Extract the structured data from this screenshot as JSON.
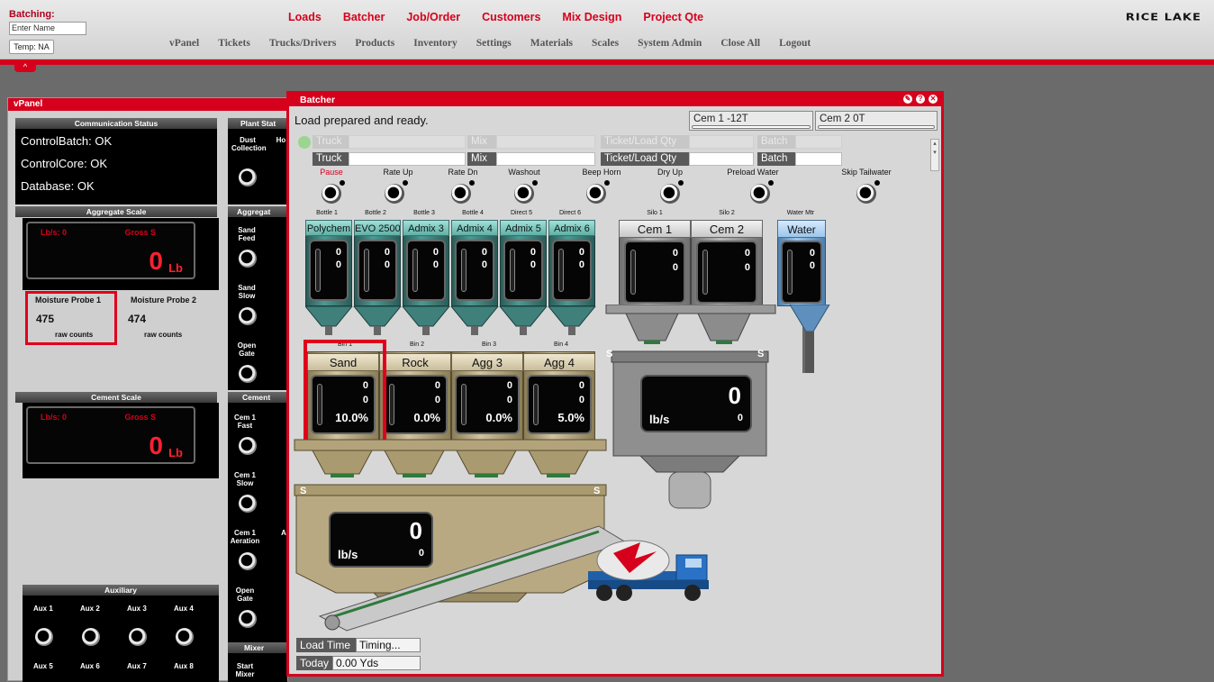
{
  "header": {
    "batching_label": "Batching:",
    "name_placeholder": "Enter Name",
    "temp_label": "Temp: NA",
    "logo": "RICE LAKE",
    "top_nav": [
      "Loads",
      "Batcher",
      "Job/Order",
      "Customers",
      "Mix Design",
      "Project Qte"
    ],
    "sub_nav": [
      "vPanel",
      "Tickets",
      "Trucks/Drivers",
      "Products",
      "Inventory",
      "Settings",
      "Materials",
      "Scales",
      "System Admin",
      "Close All",
      "Logout"
    ],
    "collapse": "^"
  },
  "vpanel": {
    "title": "vPanel",
    "comm_header": "Communication Status",
    "comm_lines": [
      "ControlBatch: OK",
      "ControlCore: OK",
      "Database: OK"
    ],
    "plant_status_header": "Plant Stat",
    "aggregate_scale_header": "Aggregate Scale",
    "aggregate_header": "Aggregat",
    "cement_scale_header": "Cement Scale",
    "cement_header": "Cement",
    "auxiliary_header": "Auxiliary",
    "mixer_header": "Mixer",
    "agg_scale": {
      "rate": "Lb/s: 0",
      "gross": "Gross S",
      "value": "0",
      "unit": "Lb"
    },
    "cem_scale": {
      "rate": "Lb/s: 0",
      "gross": "Gross S",
      "value": "0",
      "unit": "Lb"
    },
    "moisture": [
      {
        "label": "Moisture Probe 1",
        "value": "475",
        "unit": "raw counts"
      },
      {
        "label": "Moisture Probe 2",
        "value": "474",
        "unit": "raw counts"
      }
    ],
    "plant_controls": [
      "Dust Collection",
      "Ho"
    ],
    "aggregate_controls": [
      "Sand Feed",
      "Sand Slow",
      "Open Gate"
    ],
    "cement_controls": [
      "Cem 1 Fast",
      "Cem 1 Slow",
      "Cem 1 Aeration",
      "A",
      "Open Gate"
    ],
    "mixer_controls": [
      "Start Mixer"
    ],
    "aux_row1": [
      "Aux 1",
      "Aux 2",
      "Aux 3",
      "Aux 4"
    ],
    "aux_row2": [
      "Aux 5",
      "Aux 6",
      "Aux 7",
      "Aux 8"
    ]
  },
  "batcher": {
    "title": "Batcher",
    "status": "Load prepared and ready.",
    "cem_tabs": [
      "Cem 1 -12T",
      "Cem 2 0T"
    ],
    "row1": [
      "Truck",
      "Mix",
      "Ticket/Load Qty",
      "Batch"
    ],
    "row2": [
      "Truck",
      "Mix",
      "Ticket/Load Qty",
      "Batch"
    ],
    "controls": [
      "Pause",
      "Rate Up",
      "Rate Dn",
      "Washout",
      "Beep Horn",
      "Dry Up",
      "Preload Water",
      "Skip Tailwater"
    ],
    "bottles": [
      {
        "cap": "Bottle 1",
        "name": "Polychem",
        "v1": "0",
        "v2": "0"
      },
      {
        "cap": "Bottle 2",
        "name": "EVO 2500",
        "v1": "0",
        "v2": "0"
      },
      {
        "cap": "Bottle 3",
        "name": "Admix 3",
        "v1": "0",
        "v2": "0"
      },
      {
        "cap": "Bottle 4",
        "name": "Admix 4",
        "v1": "0",
        "v2": "0"
      },
      {
        "cap": "Direct 5",
        "name": "Admix 5",
        "v1": "0",
        "v2": "0"
      },
      {
        "cap": "Direct 6",
        "name": "Admix 6",
        "v1": "0",
        "v2": "0"
      }
    ],
    "silos": [
      {
        "cap": "Silo 1",
        "name": "Cem 1",
        "v1": "0",
        "v2": "0"
      },
      {
        "cap": "Silo 2",
        "name": "Cem 2",
        "v1": "0",
        "v2": "0"
      }
    ],
    "water": {
      "cap": "Water Mtr",
      "name": "Water",
      "v1": "0",
      "v2": "0"
    },
    "bins": [
      {
        "cap": "Bin 1",
        "name": "Sand",
        "v1": "0",
        "v2": "0",
        "pct": "10.0%"
      },
      {
        "cap": "Bin 2",
        "name": "Rock",
        "v1": "0",
        "v2": "0",
        "pct": "0.0%"
      },
      {
        "cap": "Bin 3",
        "name": "Agg 3",
        "v1": "0",
        "v2": "0",
        "pct": "0.0%"
      },
      {
        "cap": "Bin 4",
        "name": "Agg 4",
        "v1": "0",
        "v2": "0",
        "pct": "5.0%"
      }
    ],
    "cem_weigh": {
      "big": "0",
      "unit": "lb/s",
      "small": "0"
    },
    "agg_weigh": {
      "big": "0",
      "unit": "lb/s",
      "small": "0"
    },
    "load_time_label": "Load Time",
    "load_time_value": "Timing...",
    "today_label": "Today",
    "today_value": "0.00 Yds",
    "scale_marker": "S"
  },
  "colors": {
    "brand_red": "#d6001c",
    "panel_gray": "#cfcfcf"
  }
}
